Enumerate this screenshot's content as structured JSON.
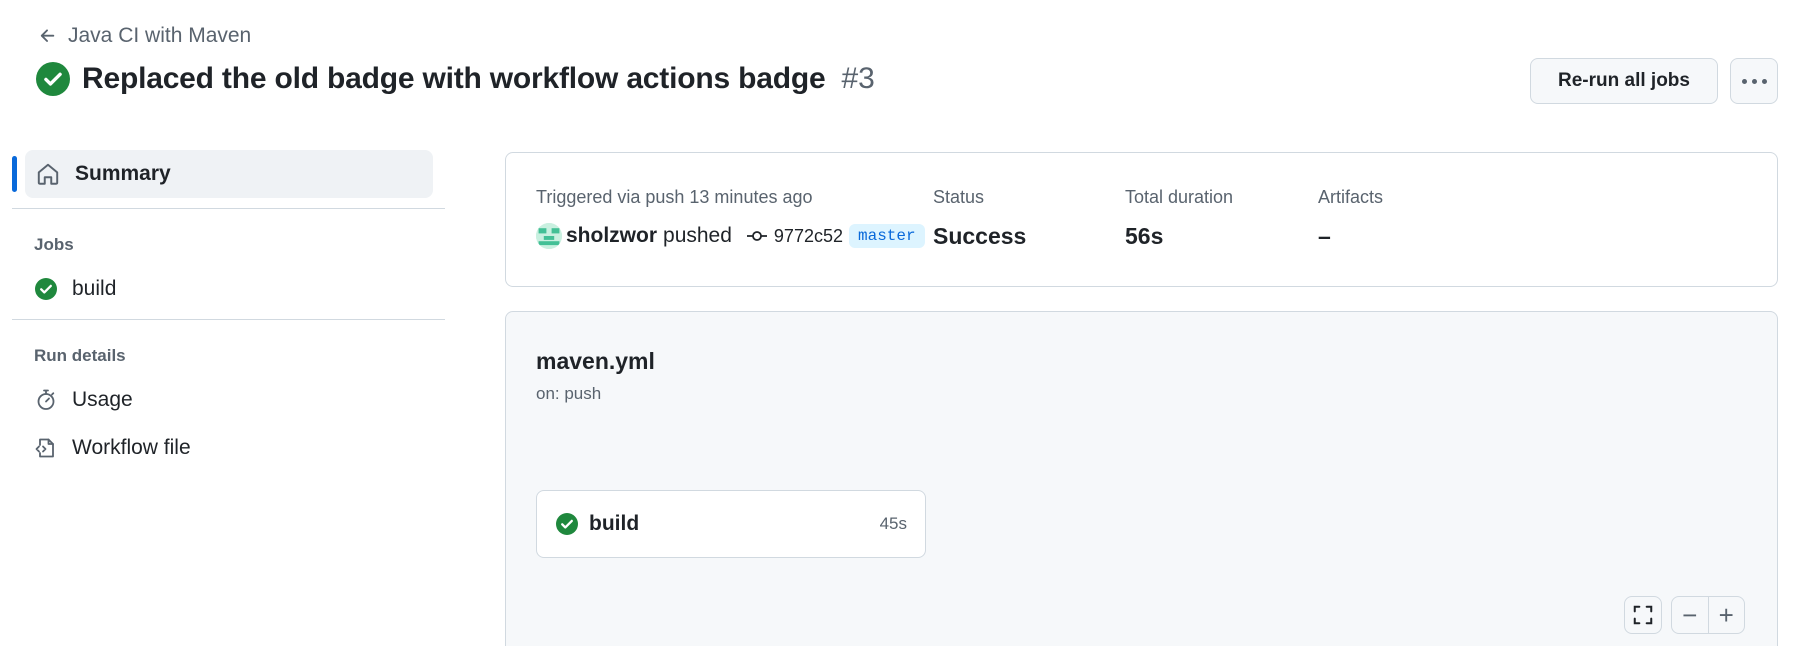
{
  "header": {
    "back_label": "Java CI with Maven",
    "title": "Replaced the old badge with workflow actions badge",
    "run_number": "#3",
    "rerun_label": "Re-run all jobs"
  },
  "sidebar": {
    "summary_label": "Summary",
    "jobs_heading": "Jobs",
    "jobs": [
      {
        "label": "build"
      }
    ],
    "run_details_heading": "Run details",
    "details": [
      {
        "label": "Usage"
      },
      {
        "label": "Workflow file"
      }
    ]
  },
  "summary": {
    "trigger_text": "Triggered via push 13 minutes ago",
    "actor": "sholzwor",
    "action": "pushed",
    "commit": "9772c52",
    "branch": "master",
    "status_label": "Status",
    "status_value": "Success",
    "duration_label": "Total duration",
    "duration_value": "56s",
    "artifacts_label": "Artifacts",
    "artifacts_value": "–"
  },
  "graph": {
    "workflow_file": "maven.yml",
    "trigger": "on: push",
    "job": {
      "name": "build",
      "duration": "45s"
    }
  },
  "colors": {
    "success": "#1f883d",
    "accent": "#0969da"
  }
}
